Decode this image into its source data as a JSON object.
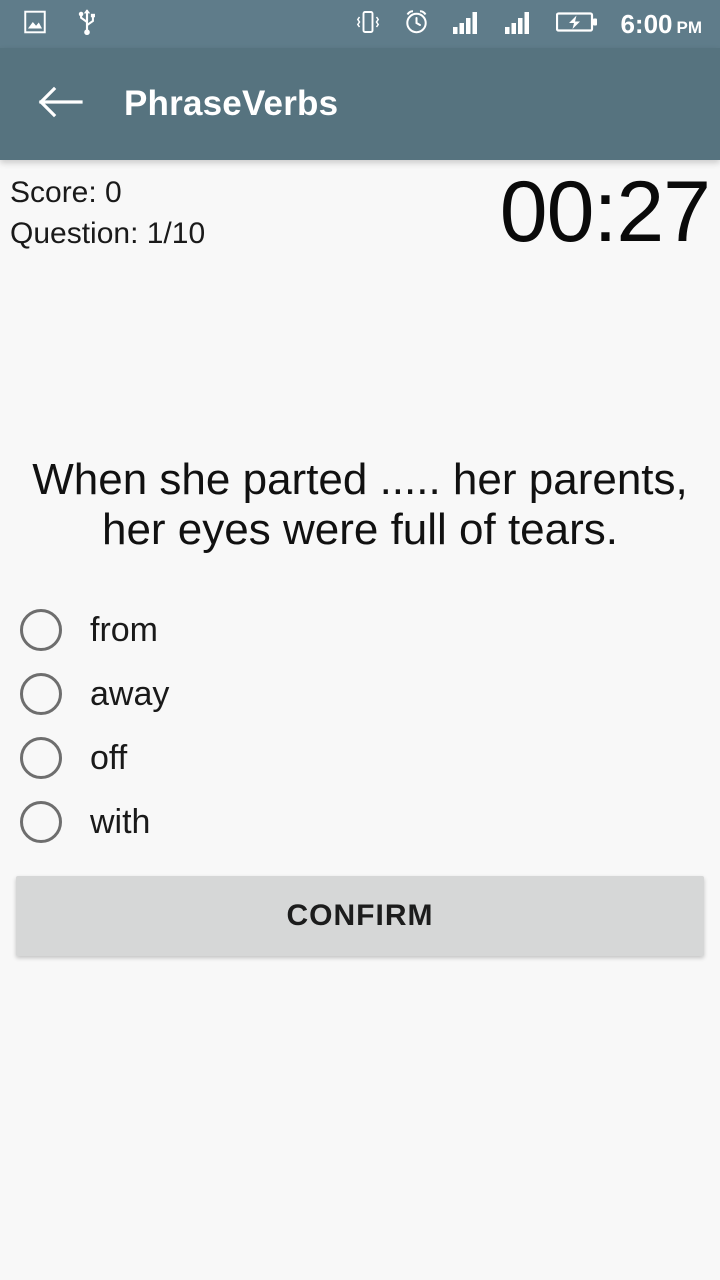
{
  "statusbar": {
    "background": "#5f7c8a",
    "left_icons": [
      {
        "name": "screenshot-image-icon"
      },
      {
        "name": "usb-icon"
      }
    ],
    "right_icons": [
      {
        "name": "vibrate-icon"
      },
      {
        "name": "alarm-clock-icon"
      },
      {
        "name": "signal-bars-sim1-icon"
      },
      {
        "name": "signal-bars-sim2-icon"
      },
      {
        "name": "battery-charging-icon"
      }
    ],
    "time": "6:00",
    "ampm": "PM"
  },
  "appbar": {
    "background": "#56737f",
    "back_icon": "arrow-left-icon",
    "title": "PhraseVerbs"
  },
  "quiz": {
    "score_label": "Score: 0",
    "question_counter": "Question: 1/10",
    "timer": "00:27",
    "question_text": "When she parted ..... her parents, her eyes were full of tears.",
    "options": [
      {
        "label": "from",
        "selected": false
      },
      {
        "label": "away",
        "selected": false
      },
      {
        "label": "off",
        "selected": false
      },
      {
        "label": "with",
        "selected": false
      }
    ],
    "confirm_label": "CONFIRM"
  }
}
